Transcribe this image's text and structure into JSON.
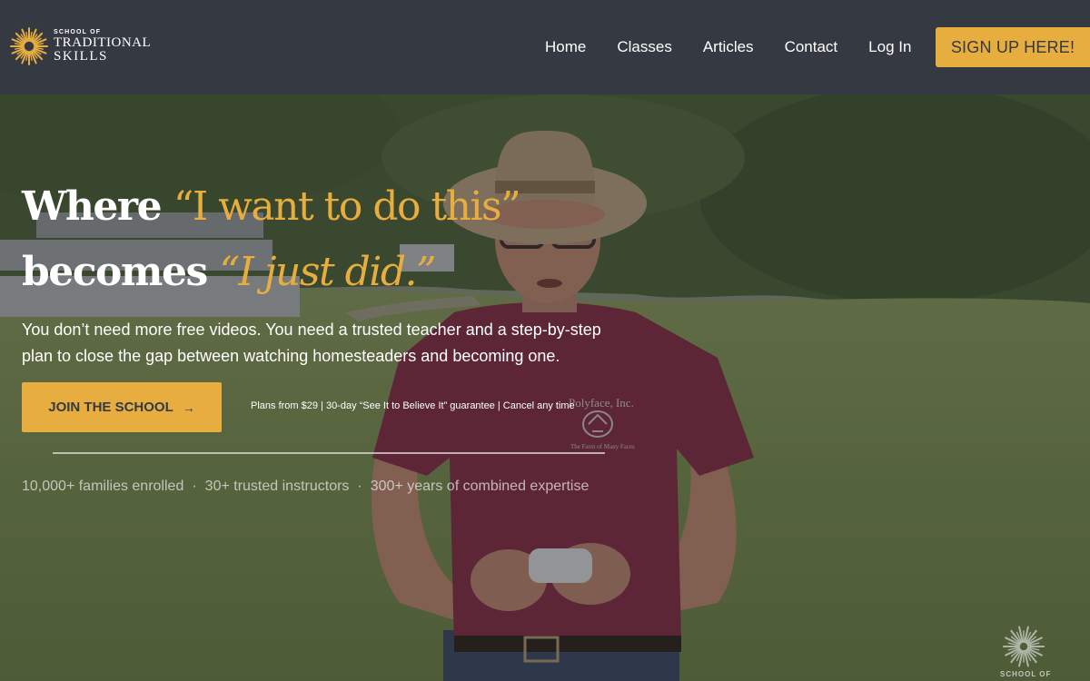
{
  "brand": {
    "small": "SCHOOL OF",
    "line1": "TRADITIONAL",
    "line2": "SKILLS",
    "color": "#e7ad3e"
  },
  "nav": {
    "links": [
      "Home",
      "Classes",
      "Articles",
      "Contact",
      "Log In"
    ],
    "signup": "SIGN UP HERE!"
  },
  "hero": {
    "headline_1_plain": "Where ",
    "headline_1_quote": "“I want to do this”",
    "headline_2_plain": "becomes ",
    "headline_2_quote": "“I just did.”",
    "subtext": "You don’t need more free videos. You need a trusted teacher and a step-by-step plan to close the gap between watching homesteaders and becoming one.",
    "cta": "JOIN THE SCHOOL",
    "cta_icon": "→",
    "plans": "Plans from $29 | 30-day “See It to Believe It” guarantee | Cancel any time",
    "stats": [
      "10,000+ families enrolled",
      "30+ trusted instructors",
      "300+ years of combined expertise"
    ],
    "stat_separator": "·",
    "shirt_text": "Polyface, Inc.",
    "shirt_subtext": "The Farm of Many Faces",
    "watermark": "SCHOOL OF"
  },
  "colors": {
    "nav_bg": "#353941",
    "accent": "#e7ad3e",
    "text": "#ffffff"
  }
}
